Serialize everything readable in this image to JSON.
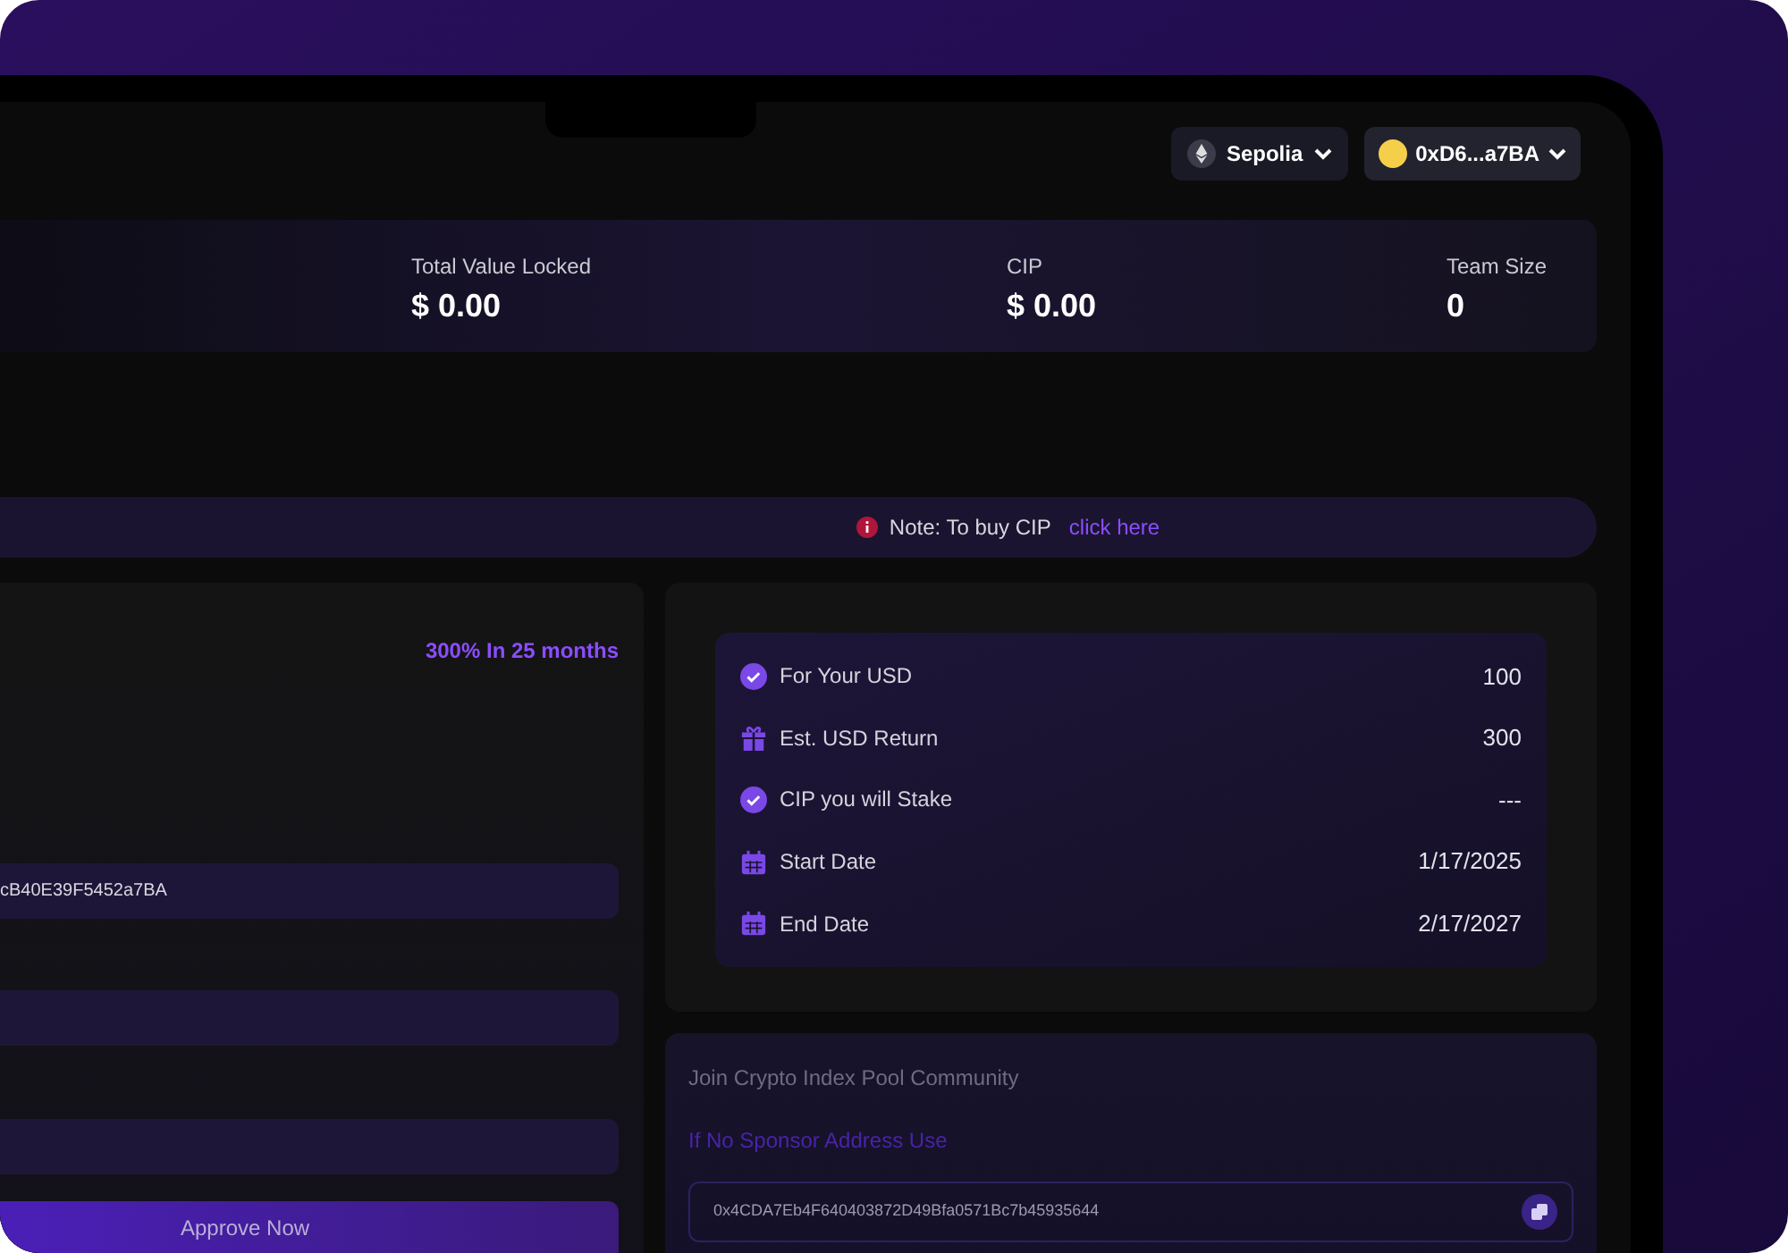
{
  "header": {
    "network": {
      "label": "Sepolia"
    },
    "wallet": {
      "label": "0xD6...a7BA"
    }
  },
  "stats": [
    {
      "label": "Total Value Locked",
      "value": "$ 0.00"
    },
    {
      "label": "CIP",
      "value": "$ 0.00"
    },
    {
      "label": "Team Size",
      "value": "0"
    }
  ],
  "note": {
    "text": "Note: To buy CIP",
    "link": "click here"
  },
  "stake_form": {
    "return_rate": "300% In 25 months",
    "fields": [
      {
        "value": "cB40E39F5452a7BA"
      }
    ],
    "button": "Approve Now"
  },
  "summary": [
    {
      "kind": "check",
      "label": "For Your USD",
      "value": "100"
    },
    {
      "kind": "gift",
      "label": "Est. USD Return",
      "value": "300"
    },
    {
      "kind": "check",
      "label": "CIP you will Stake",
      "value": "---"
    },
    {
      "kind": "calendar",
      "label": "Start Date",
      "value": "1/17/2025"
    },
    {
      "kind": "calendar",
      "label": "End Date",
      "value": "2/17/2027"
    }
  ],
  "community": {
    "title": "Join Crypto Index Pool Community",
    "subtitle": "If No Sponsor Address Use",
    "address": "0x4CDA7Eb4F640403872D49Bfa0571Bc7b45935644"
  }
}
